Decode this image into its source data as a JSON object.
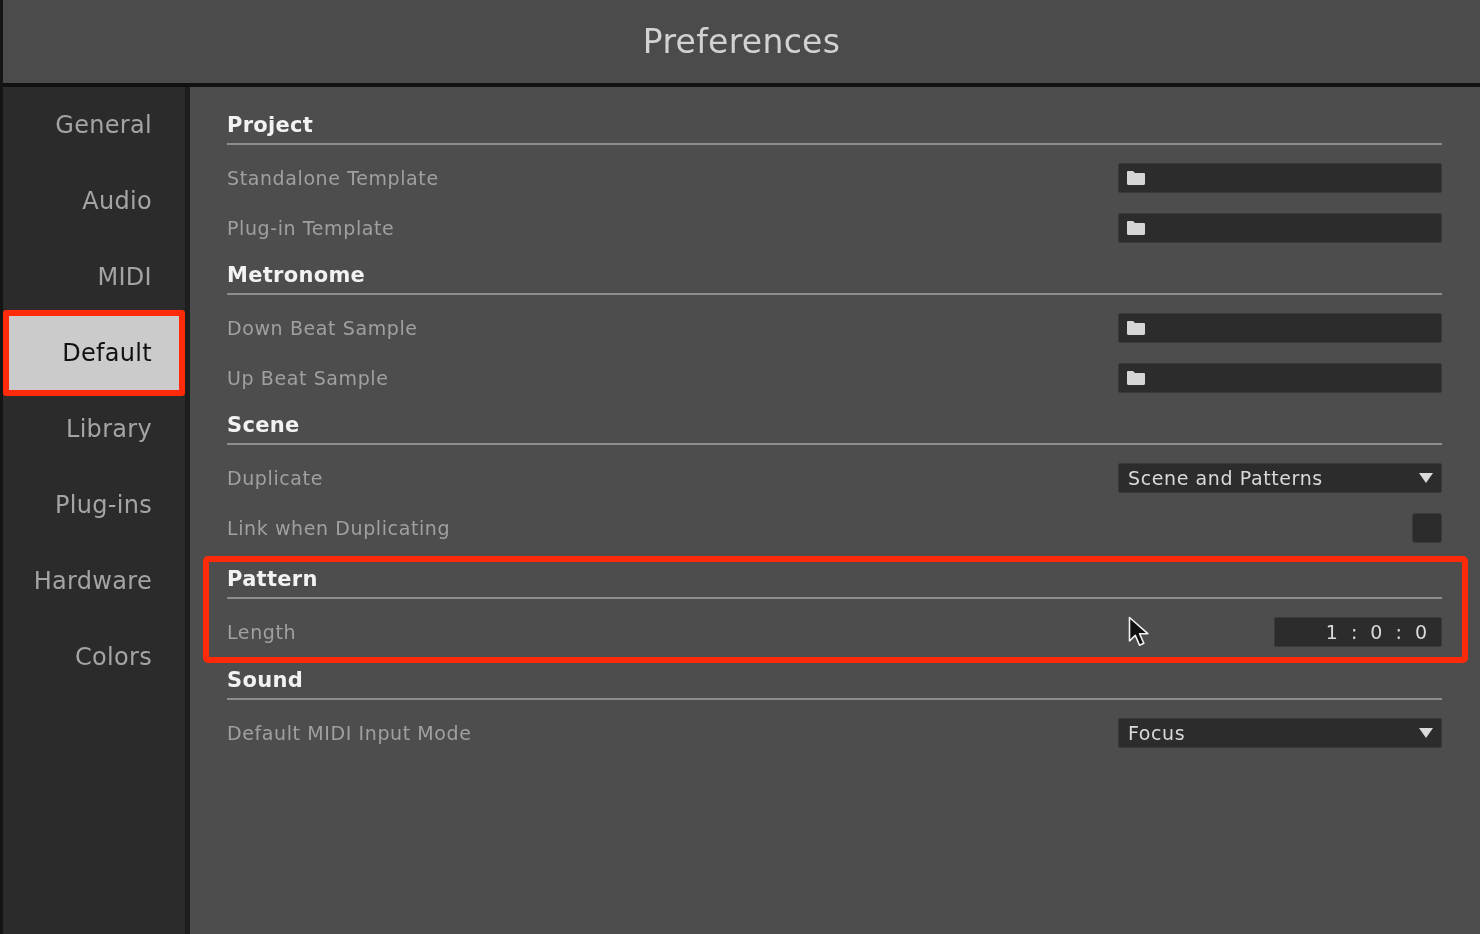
{
  "window": {
    "title": "Preferences"
  },
  "sidebar": {
    "items": [
      {
        "label": "General",
        "selected": false,
        "highlighted": false
      },
      {
        "label": "Audio",
        "selected": false,
        "highlighted": false
      },
      {
        "label": "MIDI",
        "selected": false,
        "highlighted": false
      },
      {
        "label": "Default",
        "selected": true,
        "highlighted": true
      },
      {
        "label": "Library",
        "selected": false,
        "highlighted": false
      },
      {
        "label": "Plug-ins",
        "selected": false,
        "highlighted": false
      },
      {
        "label": "Hardware",
        "selected": false,
        "highlighted": false
      },
      {
        "label": "Colors",
        "selected": false,
        "highlighted": false
      }
    ]
  },
  "sections": [
    {
      "title": "Project",
      "highlighted": false,
      "rows": [
        {
          "label": "Standalone Template",
          "kind": "path"
        },
        {
          "label": "Plug-in Template",
          "kind": "path"
        }
      ]
    },
    {
      "title": "Metronome",
      "highlighted": false,
      "rows": [
        {
          "label": "Down Beat Sample",
          "kind": "path"
        },
        {
          "label": "Up Beat Sample",
          "kind": "path"
        }
      ]
    },
    {
      "title": "Scene",
      "highlighted": false,
      "rows": [
        {
          "label": "Duplicate",
          "kind": "dropdown",
          "value": "Scene and Patterns"
        },
        {
          "label": "Link when Duplicating",
          "kind": "checkbox",
          "checked": false
        }
      ]
    },
    {
      "title": "Pattern",
      "highlighted": true,
      "rows": [
        {
          "label": "Length",
          "kind": "value",
          "value": "1 : 0 : 0"
        }
      ]
    },
    {
      "title": "Sound",
      "highlighted": false,
      "rows": [
        {
          "label": "Default MIDI Input Mode",
          "kind": "dropdown",
          "value": "Focus"
        }
      ]
    }
  ]
}
